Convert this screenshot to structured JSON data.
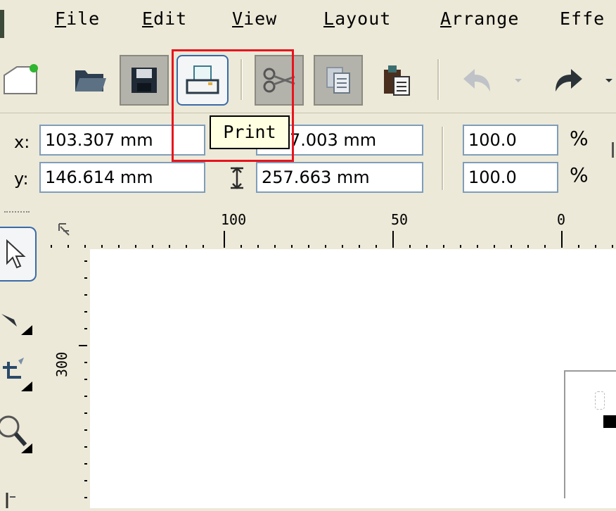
{
  "menu": {
    "items": [
      {
        "mnemonic": "F",
        "rest": "ile"
      },
      {
        "mnemonic": "E",
        "rest": "dit"
      },
      {
        "mnemonic": "V",
        "rest": "iew"
      },
      {
        "mnemonic": "L",
        "rest": "ayout"
      },
      {
        "mnemonic": "A",
        "rest": "rrange"
      },
      {
        "mnemonic": "",
        "rest": "Effe"
      }
    ]
  },
  "tooltip": {
    "text": "Print"
  },
  "propbar": {
    "x_label": "x:",
    "y_label": "y:",
    "x_value": "103.307 mm",
    "y_value": "146.614 mm",
    "width_value": "7.003 mm",
    "height_value": "257.663 mm",
    "scale_x": "100.0",
    "scale_y": "100.0",
    "percent": "%"
  },
  "ruler": {
    "top_labels": [
      "100",
      "50",
      "0"
    ],
    "left_label": "300"
  },
  "colors": {
    "chrome": "#ece9d8",
    "highlight": "#e8141e",
    "field_border": "#7f9db9"
  }
}
